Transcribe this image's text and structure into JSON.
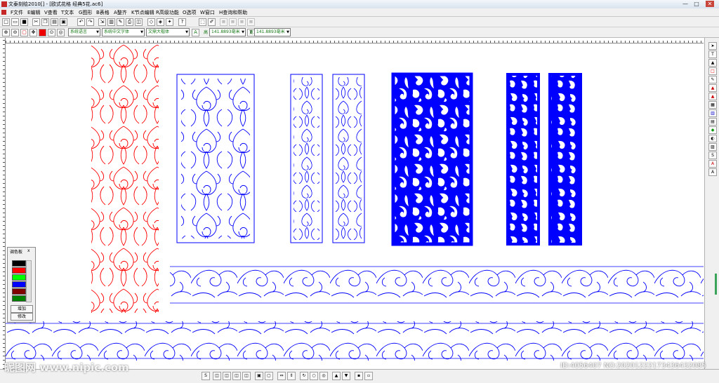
{
  "window": {
    "title": "文泰刻绘2010[]  - [欧式花格 经典5花.ac6]",
    "minimize": "—",
    "maximize": "□",
    "close": "✕"
  },
  "menu": [
    "F文件",
    "E编辑",
    "V查看",
    "T文本",
    "G图形",
    "B表格",
    "A整齐",
    "K节点编辑",
    "R高级功能",
    "O选项",
    "W窗口",
    "H查询和帮助"
  ],
  "toolbar2": {
    "language": "系统语言",
    "font_cn": "系统中文字体",
    "font_en": "文鼎大楷体",
    "height_label": "高",
    "height_value": "141.8893毫米",
    "width_label": "宽",
    "width_value": "141.8893毫米"
  },
  "palette": {
    "title": "调色板",
    "close": "x",
    "swatches": [
      "#000000",
      "#ff0000",
      "#00ff00",
      "#0000ff",
      "#800000",
      "#008000"
    ],
    "add_button": "增加",
    "edit_button": "修改"
  },
  "colors": {
    "red_pattern": "#ff0000",
    "blue_pattern": "#0000ff",
    "accent": "#1a7a1a"
  },
  "watermark": {
    "logo": "昵图网 www.nipic.com",
    "id": "ID:4056407 NO:20201222173436432085"
  }
}
